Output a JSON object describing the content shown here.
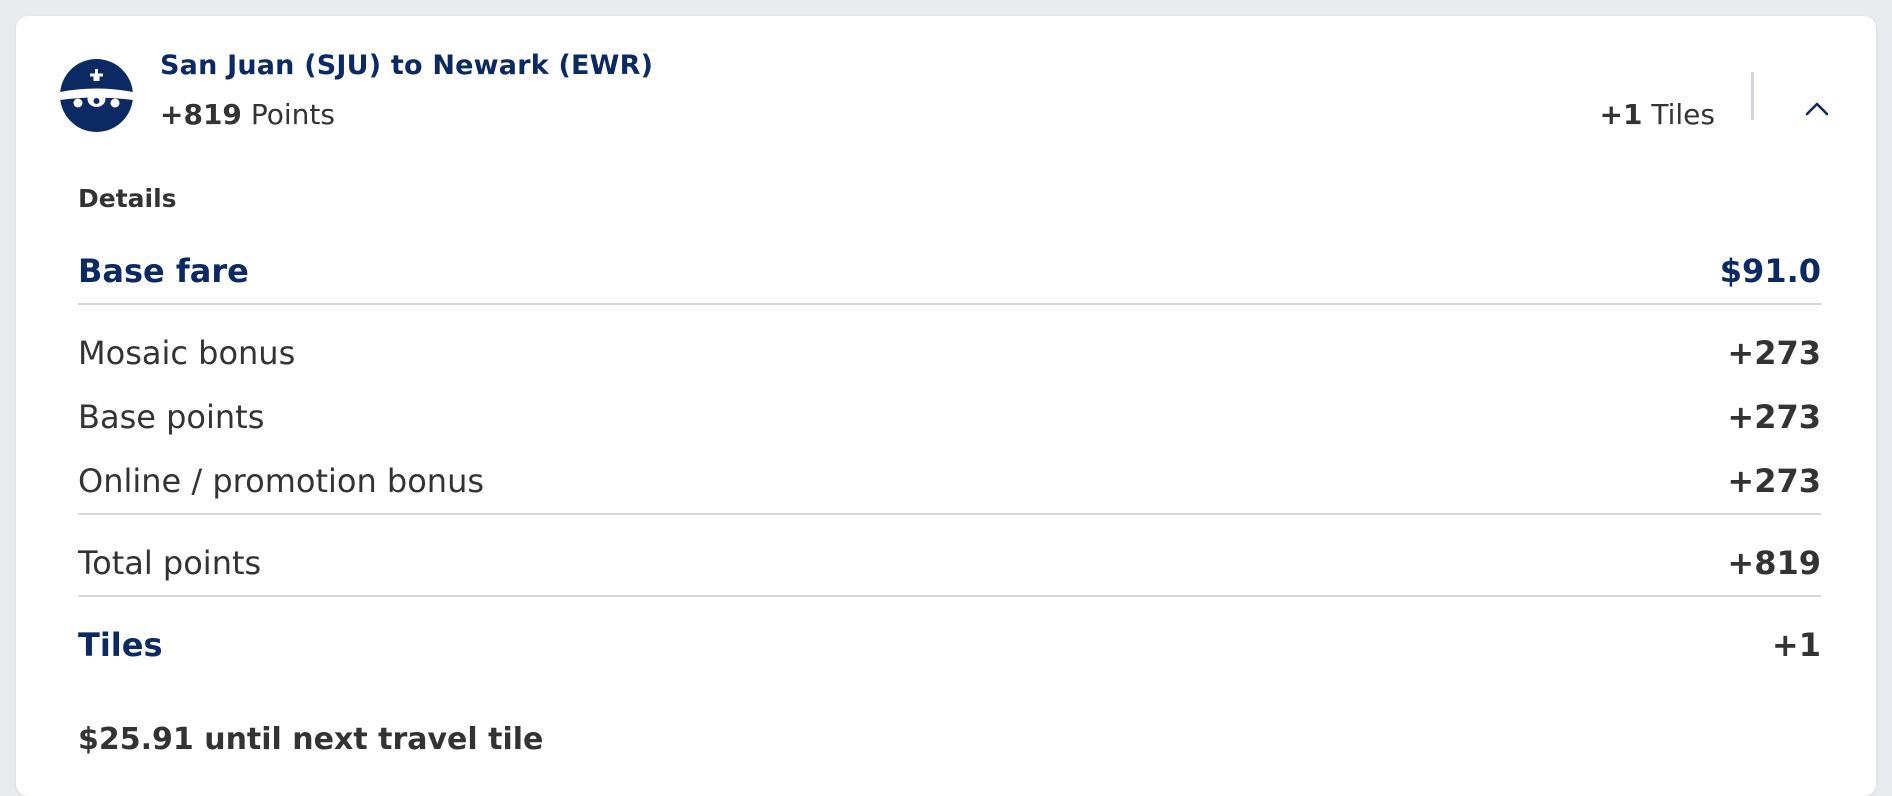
{
  "header": {
    "route_title": "San Juan (SJU) to Newark (EWR)",
    "points_value": "+819",
    "points_label": "Points",
    "tiles_value": "+1",
    "tiles_label": "Tiles",
    "plane_icon": "airplane-icon",
    "collapse_icon": "chevron-up-icon"
  },
  "details": {
    "label": "Details",
    "base_fare": {
      "label": "Base fare",
      "value": "$91.0"
    },
    "rows": [
      {
        "label": "Mosaic bonus",
        "value": "+273"
      },
      {
        "label": "Base points",
        "value": "+273"
      },
      {
        "label": "Online / promotion bonus",
        "value": "+273"
      }
    ],
    "total": {
      "label": "Total points",
      "value": "+819"
    },
    "tiles": {
      "label": "Tiles",
      "value": "+1"
    },
    "next_tile_note": "$25.91 until next travel tile"
  },
  "colors": {
    "brand_navy": "#0b2a64",
    "text": "#333333",
    "divider": "#d8d8d8",
    "page_bg": "#e9eaee"
  }
}
